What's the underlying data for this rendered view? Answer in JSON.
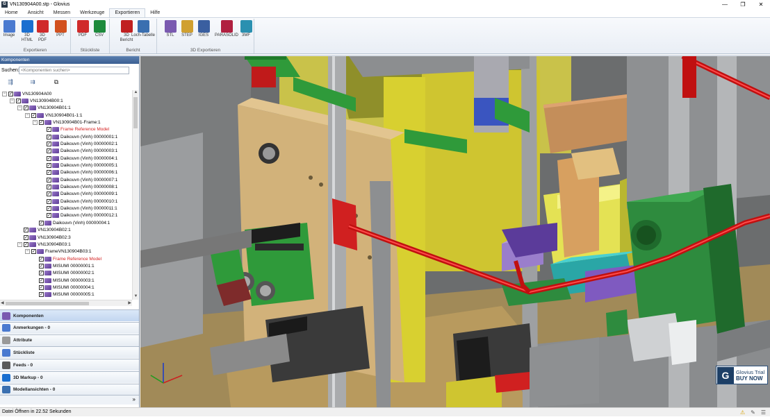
{
  "window": {
    "title": "VN130904A00.stp - Glovius",
    "app_icon": "G",
    "min": "—",
    "max": "❐",
    "close": "✕"
  },
  "menu": {
    "tabs": [
      "Home",
      "Ansicht",
      "Messen",
      "Werkzeuge",
      "Exportieren",
      "Hilfe"
    ],
    "active": "Exportieren"
  },
  "ribbon": {
    "groups": [
      {
        "label": "Exportieren",
        "buttons": [
          {
            "label": "Image",
            "icon": "image-icon"
          },
          {
            "label": "3D\nHTML",
            "icon": "ie-html-icon"
          },
          {
            "label": "3D\nPDF",
            "icon": "pdf-icon"
          },
          {
            "label": "PPT",
            "icon": "ppt-icon"
          }
        ]
      },
      {
        "label": "Stückliste",
        "buttons": [
          {
            "label": "PDF",
            "icon": "pdf-icon"
          },
          {
            "label": "CSV",
            "icon": "excel-icon"
          }
        ]
      },
      {
        "label": "Bericht",
        "buttons": [
          {
            "label": "3D\nBericht",
            "icon": "report-icon"
          },
          {
            "label": "Loch-Tabelle",
            "icon": "hole-table-icon"
          }
        ]
      },
      {
        "label": "3D Exportieren",
        "buttons": [
          {
            "label": "STL",
            "icon": "stl-icon"
          },
          {
            "label": "STEP",
            "icon": "step-icon"
          },
          {
            "label": "IGES",
            "icon": "iges-icon"
          },
          {
            "label": "PARASOLID",
            "icon": "parasolid-icon"
          },
          {
            "label": "3MF",
            "icon": "3mf-icon"
          }
        ]
      }
    ]
  },
  "panel": {
    "header": "Komponenten",
    "search_label": "Suchen:",
    "search_placeholder": "<Komponenten suchen>",
    "tree": [
      {
        "label": "VN130904A00",
        "level": 0,
        "exp": "−"
      },
      {
        "label": "VN130904B00:1",
        "level": 1,
        "exp": "−"
      },
      {
        "label": "VN130904B01:1",
        "level": 2,
        "exp": "−"
      },
      {
        "label": "VN130904B01-1:1",
        "level": 3,
        "exp": "−"
      },
      {
        "label": "VN130904B01-Frame:1",
        "level": 4,
        "exp": "−"
      },
      {
        "label": "Frame Reference Model",
        "level": 5,
        "red": true
      },
      {
        "label": "Daikouvn (Vinh)  00000001:1",
        "level": 5
      },
      {
        "label": "Daikouvn (Vinh)  00000002:1",
        "level": 5
      },
      {
        "label": "Daikouvn (Vinh)  00000003:1",
        "level": 5
      },
      {
        "label": "Daikouvn (Vinh)  00000004:1",
        "level": 5
      },
      {
        "label": "Daikouvn (Vinh)  00000005:1",
        "level": 5
      },
      {
        "label": "Daikouvn (Vinh)  00000006:1",
        "level": 5
      },
      {
        "label": "Daikouvn (Vinh)  00000007:1",
        "level": 5
      },
      {
        "label": "Daikouvn (Vinh)  00000008:1",
        "level": 5
      },
      {
        "label": "Daikouvn (Vinh)  00000009:1",
        "level": 5
      },
      {
        "label": "Daikouvn (Vinh)  00000010:1",
        "level": 5
      },
      {
        "label": "Daikouvn (Vinh)  00000011:1",
        "level": 5
      },
      {
        "label": "Daikouvn (Vinh)  00000012:1",
        "level": 5
      },
      {
        "label": "Daikouvn (Vinh)  00000004:1",
        "level": 4
      },
      {
        "label": "VN130904B02:1",
        "level": 2
      },
      {
        "label": "VN130904B02:3",
        "level": 2
      },
      {
        "label": "VN130904B03:1",
        "level": 2,
        "exp": "−"
      },
      {
        "label": "FrameVN130904B03:1",
        "level": 3,
        "exp": "−"
      },
      {
        "label": "Frame Reference Model",
        "level": 4,
        "red": true
      },
      {
        "label": "MISUMI  00000001:1",
        "level": 4
      },
      {
        "label": "MISUMI  00000002:1",
        "level": 4
      },
      {
        "label": "MISUMI  00000003:1",
        "level": 4
      },
      {
        "label": "MISUMI  00000004:1",
        "level": 4
      },
      {
        "label": "MISUMI  00000005:1",
        "level": 4
      }
    ],
    "nav": [
      {
        "label": "Komponenten",
        "icon": "components-icon",
        "selected": true
      },
      {
        "label": "Anmerkungen - 0",
        "icon": "annotations-icon"
      },
      {
        "label": "Attribute",
        "icon": "attributes-icon"
      },
      {
        "label": "Stückliste",
        "icon": "bom-icon"
      },
      {
        "label": "Feeds - 0",
        "icon": "feeds-icon"
      },
      {
        "label": "3D Markup - 0",
        "icon": "markup-icon"
      },
      {
        "label": "Modellansichten - 0",
        "icon": "model-views-icon"
      }
    ],
    "more": "»"
  },
  "trial": {
    "line1": "Glovius Trial",
    "line2": "BUY NOW",
    "logo": "G"
  },
  "status": {
    "text": "Datei Öffnen in 22.52 Sekunden",
    "icons": [
      "warning-icon",
      "wrench-icon",
      "bell-icon"
    ]
  }
}
